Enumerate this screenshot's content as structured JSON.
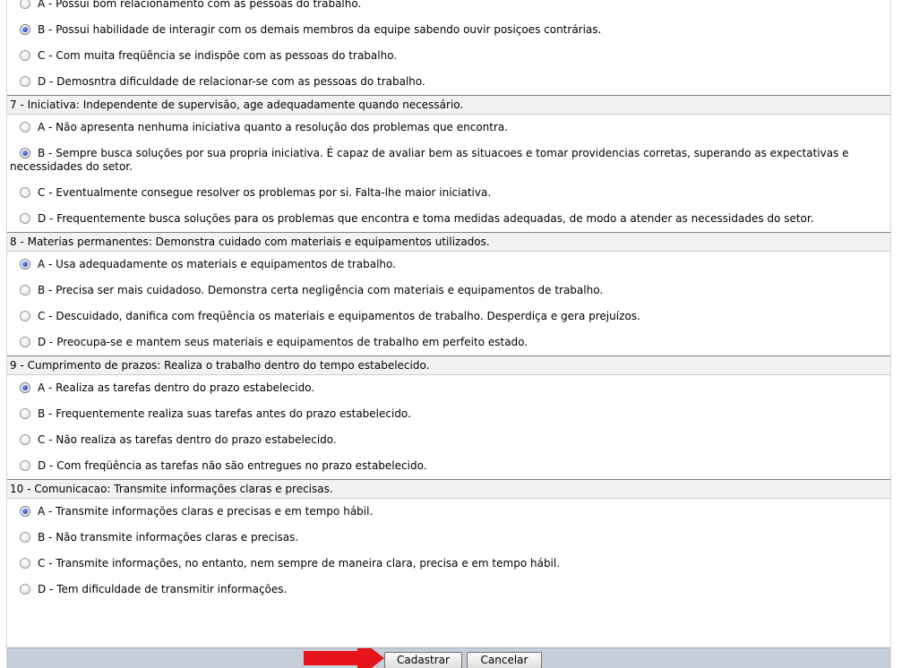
{
  "sections": [
    {
      "options": [
        {
          "text": "A - Possui bom relacionamento com as pessoas do trabalho.",
          "checked": false
        },
        {
          "text": "B - Possui habilidade de interagir com os demais membros da equipe sabendo ouvir posiçoes contrárias.",
          "checked": true
        },
        {
          "text": "C - Com muita freqüência se indispõe com as pessoas do trabalho.",
          "checked": false
        },
        {
          "text": "D - Demosntra dificuldade de relacionar-se com as pessoas do trabalho.",
          "checked": false
        }
      ]
    },
    {
      "title": "7 - Iniciativa: Independente de supervisão, age adequadamente quando necessário.",
      "options": [
        {
          "text": "A - Não apresenta nenhuma iniciativa quanto a resolução dos problemas que encontra.",
          "checked": false
        },
        {
          "text": "B - Sempre busca soluções por sua propria iniciativa. É capaz de avaliar bem as situacoes e tomar providencias corretas, superando as expectativas e necessidades do setor.",
          "checked": true
        },
        {
          "text": "C - Eventualmente consegue resolver os problemas por si. Falta-lhe maior iniciativa.",
          "checked": false
        },
        {
          "text": "D - Frequentemente busca soluções para os problemas que encontra e toma medidas adequadas, de modo a atender as necessidades do setor.",
          "checked": false
        }
      ]
    },
    {
      "title": "8 - Materias permanentes: Demonstra cuidado com materiais e equipamentos utilizados.",
      "options": [
        {
          "text": "A - Usa adequadamente os materiais e equipamentos de trabalho.",
          "checked": true
        },
        {
          "text": "B - Precisa ser mais cuidadoso. Demonstra certa negligência com materiais e equipamentos de trabalho.",
          "checked": false
        },
        {
          "text": "C - Descuidado, danifica com freqüência os materiais e equipamentos de trabalho. Desperdiça e gera prejuízos.",
          "checked": false
        },
        {
          "text": "D - Preocupa-se e mantem seus materiais e equipamentos de trabalho em perfeito estado.",
          "checked": false
        }
      ]
    },
    {
      "title": "9 - Cumprimento de prazos: Realiza o trabalho dentro do tempo estabelecido.",
      "options": [
        {
          "text": "A - Realiza as tarefas dentro do prazo estabelecido.",
          "checked": true
        },
        {
          "text": "B - Frequentemente realiza suas tarefas antes do prazo estabelecido.",
          "checked": false
        },
        {
          "text": "C - Não realiza as tarefas dentro do prazo estabelecido.",
          "checked": false
        },
        {
          "text": "D - Com freqüência as tarefas não são entregues no prazo estabelecido.",
          "checked": false
        }
      ]
    },
    {
      "title": "10 - Comunicacao: Transmite informações claras e precisas.",
      "options": [
        {
          "text": "A - Transmite informações claras e precisas e em tempo hábil.",
          "checked": true
        },
        {
          "text": "B - Não transmite informações claras e precisas.",
          "checked": false
        },
        {
          "text": "C - Transmite informações, no entanto, nem sempre de maneira clara, precisa e em tempo hábil.",
          "checked": false
        },
        {
          "text": "D - Tem dificuldade de transmitir informações.",
          "checked": false
        }
      ]
    }
  ],
  "buttons": {
    "submit": "Cadastrar",
    "cancel": "Cancelar"
  },
  "colors": {
    "arrow": "#e8141b",
    "footer": "#c8cdda",
    "radio_selected": "#2d51c8"
  }
}
